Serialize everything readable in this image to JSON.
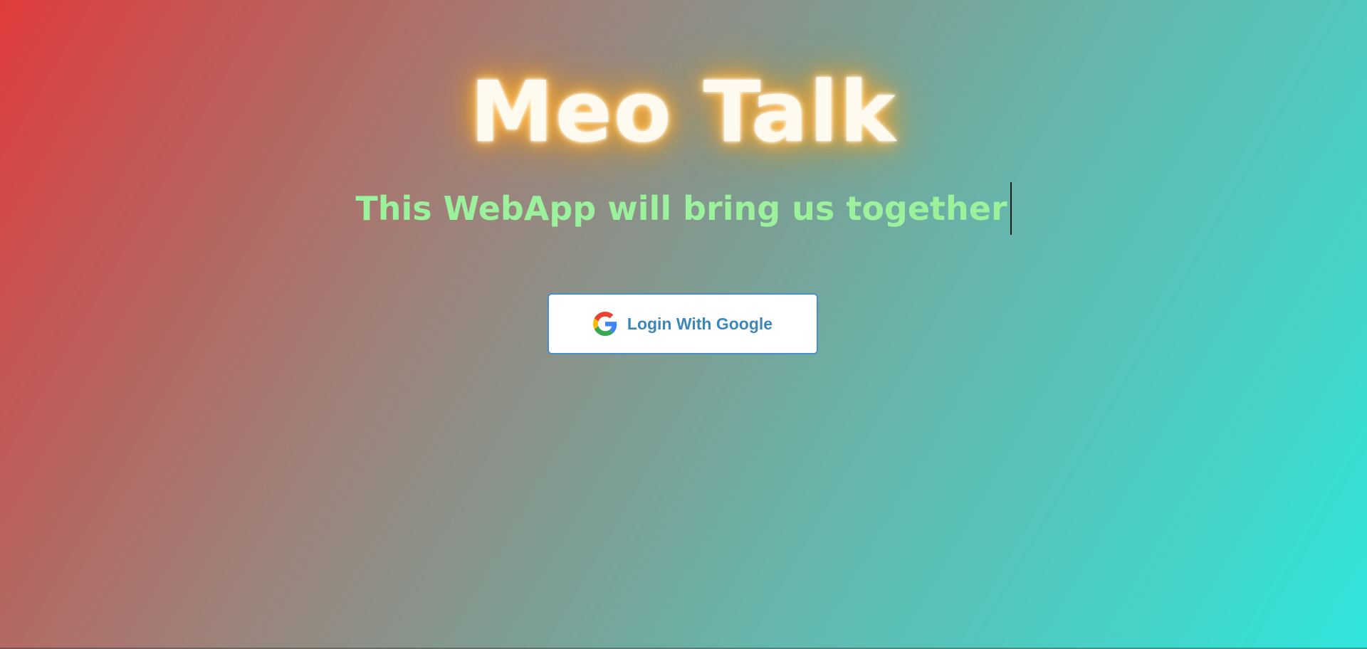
{
  "app": {
    "title": "Meo Talk",
    "tagline": "This WebApp will bring us together"
  },
  "login": {
    "label": "Login With Google",
    "icon": "google-icon"
  },
  "colors": {
    "gradient_start": "#e03c3c",
    "gradient_end": "#2fe6dc",
    "title_glow": "#f5a623",
    "tagline": "#9cf29c",
    "button_text": "#3d86b8",
    "button_border": "#4b8fc2"
  }
}
